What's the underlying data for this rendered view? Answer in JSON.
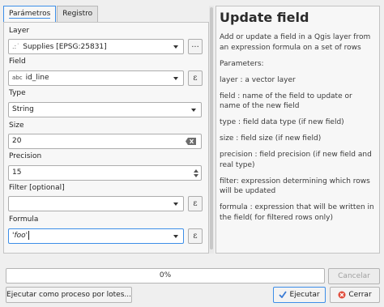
{
  "tabs": [
    {
      "label": "Parámetros",
      "active": true
    },
    {
      "label": "Registro",
      "active": false
    }
  ],
  "form": {
    "layer_label": "Layer",
    "layer_value": "Supplies [EPSG:25831]",
    "layer_prefix": ".:˙",
    "layer_browse": "...",
    "field_label": "Field",
    "field_prefix": "abc",
    "field_value": "id_line",
    "type_label": "Type",
    "type_value": "String",
    "size_label": "Size",
    "size_value": "20",
    "precision_label": "Precision",
    "precision_value": "15",
    "filter_label": "Filter [optional]",
    "filter_value": "",
    "formula_label": "Formula",
    "formula_value": "'foo'",
    "expr_symbol": "ε"
  },
  "help": {
    "title": "Update field",
    "paragraphs": [
      "Add or update a field in a Qgis layer from an expression formula on a set of rows",
      "Parameters:",
      "layer : a vector layer",
      "field : name of the field to update or name of the new field",
      "type : field data type (if new field)",
      "size : field size (if new field)",
      "precision : field precision (if new field and real type)",
      "filter: expression determining which rows will be updated",
      "formula : expression that will be written in the field( for filtered rows only)"
    ]
  },
  "progress": {
    "value": 0,
    "label": "0%"
  },
  "buttons": {
    "cancel": "Cancelar",
    "batch": "Ejecutar como proceso por lotes...",
    "run": "Ejecutar",
    "close": "Cerrar"
  },
  "colors": {
    "accent": "#3d8ee8",
    "run_icon": "#3a7bd5",
    "close_icon": "#e04b3a"
  }
}
